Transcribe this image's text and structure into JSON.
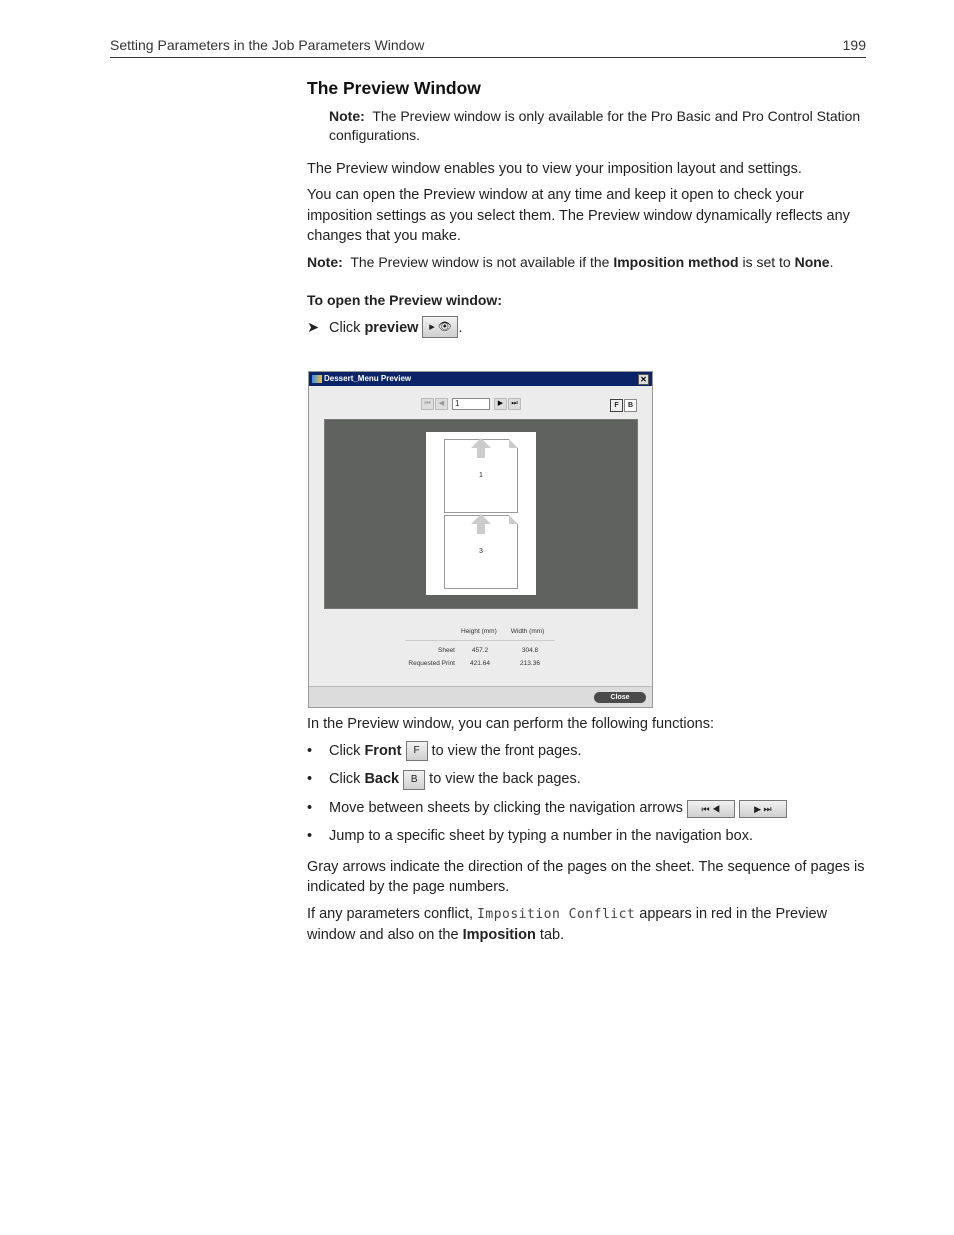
{
  "header": {
    "title": "Setting Parameters in the Job Parameters Window",
    "page_number": "199"
  },
  "section_title": "The Preview Window",
  "note1": {
    "label": "Note:",
    "text": "The Preview window is only available for the Pro Basic and Pro Control Station configurations."
  },
  "para1": "The Preview window enables you to view your imposition layout and settings.",
  "para2": "You can open the Preview window at any time and keep it open to check your imposition settings as you select them. The Preview window dynamically reflects any changes that you make.",
  "note2": {
    "label": "Note:",
    "text_pre": "The Preview window is not available if the ",
    "bold1": "Imposition method",
    "text_mid": " is set to ",
    "bold2": "None",
    "text_end": "."
  },
  "procedure_title": "To open the Preview window:",
  "step": {
    "pre": "Click ",
    "bold": "preview",
    "post": ".",
    "icon": "preview-eye-icon"
  },
  "window": {
    "title": "Dessert_Menu Preview",
    "nav_value": "1",
    "front_label": "F",
    "back_label": "B",
    "pages": [
      "1",
      "3"
    ],
    "dims": {
      "headers": [
        "Height (mm)",
        "Width (mm)"
      ],
      "rows": [
        {
          "label": "Sheet",
          "height": "457.2",
          "width": "304.8"
        },
        {
          "label": "Requested Print",
          "height": "421.64",
          "width": "213.36"
        }
      ]
    },
    "close_label": "Close"
  },
  "intro_functions": "In the Preview window, you can perform the following functions:",
  "bullets": [
    {
      "pre": "Click ",
      "bold": "Front",
      "post": " to view the front pages."
    },
    {
      "pre": "Click ",
      "bold": "Back",
      "post": " to view the back pages."
    },
    {
      "pre": "Move between sheets by clicking the navigation arrows"
    },
    {
      "pre": "Jump to a specific sheet by typing a number in the navigation box."
    }
  ],
  "para3": "Gray arrows indicate the direction of the pages on the sheet. The sequence of pages is indicated by the page numbers.",
  "para4": {
    "pre": "If any parameters conflict, ",
    "mono": "Imposition Conflict",
    "mid": " appears in red in the Preview window and also on the ",
    "bold": "Imposition",
    "post": " tab."
  }
}
